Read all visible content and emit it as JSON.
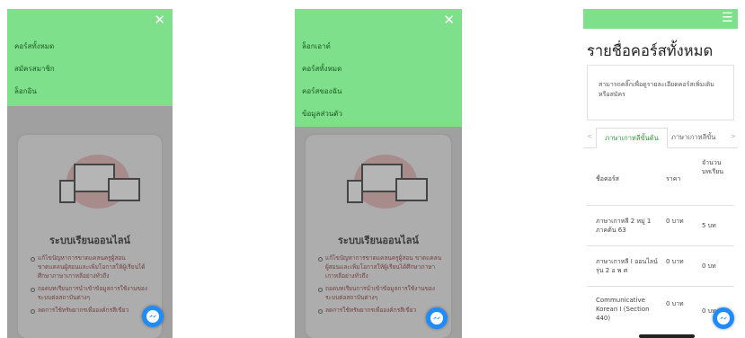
{
  "panel1": {
    "menu_items": [
      "คอร์สทั้งหมด",
      "สมัครสมาชิก",
      "ล็อกอิน"
    ],
    "close_glyph": "✕",
    "card_title": "ระบบเรียนออนไลน์",
    "card_list": [
      "แก้ไขปัญหาการขาดแคลนครูผู้สอน ขาดแคลนผู้สอนและเพิ่มโอกาสให้ผู้เรียนได้ศึกษาภาษาเกาหลีอย่างทั่วถึง",
      "ถอดบทเรียนการนำเข้าข้อมูลการใช้งานของระบบต่อสถาบันต่างๆ",
      "ลดการใช้ทรัพยากรเพื่อองค์กรสีเขียว"
    ]
  },
  "panel2": {
    "menu_items": [
      "ล็อกเอาต์",
      "คอร์สทั้งหมด",
      "คอร์สของฉัน",
      "ข้อมูลส่วนตัว"
    ],
    "close_glyph": "✕",
    "card_title": "ระบบเรียนออนไลน์",
    "card_list": [
      "แก้ไขปัญหาการขาดแคลนครูผู้สอน ขาดแคลนผู้สอนและเพิ่มโอกาสให้ผู้เรียนได้ศึกษาภาษาเกาหลีอย่างทั่วถึง",
      "ถอดบทเรียนการนำเข้าข้อมูลการใช้งานของระบบต่อสถาบันต่างๆ",
      "ลดการใช้ทรัพยากรเพื่อองค์กรสีเขียว"
    ]
  },
  "panel3": {
    "menu_glyph": "☰",
    "title": "รายชื่อคอร์สทั้งหมด",
    "info": "สามารถคลิ๊กเพื่อดูรายละเอียดคอร์สเพิ่มเติม หรือสมัคร",
    "tabs": [
      "ภาษาเกาหลีขั้นต้น",
      "ภาษาเกาหลีขั้น"
    ],
    "table": {
      "headers": [
        "ชื่อคอร์ส",
        "ราคา",
        "จำนวนบทเรียน"
      ],
      "rows": [
        [
          "ภาษาเกาหลี 2 หมู่ 1 ภาคต้น 63",
          "0 บาท",
          "5 บท"
        ],
        [
          "ภาษาเกาหลี I ออนไลน์ รุ่น 2 อ พ ศ",
          "0 บาท",
          "0 บท"
        ],
        [
          "Communicative Korean I (Section 440)",
          "0 บาท",
          "0 บท"
        ]
      ]
    }
  },
  "colors": {
    "accent": "#7fe08b",
    "messenger": "#1e8cff"
  }
}
